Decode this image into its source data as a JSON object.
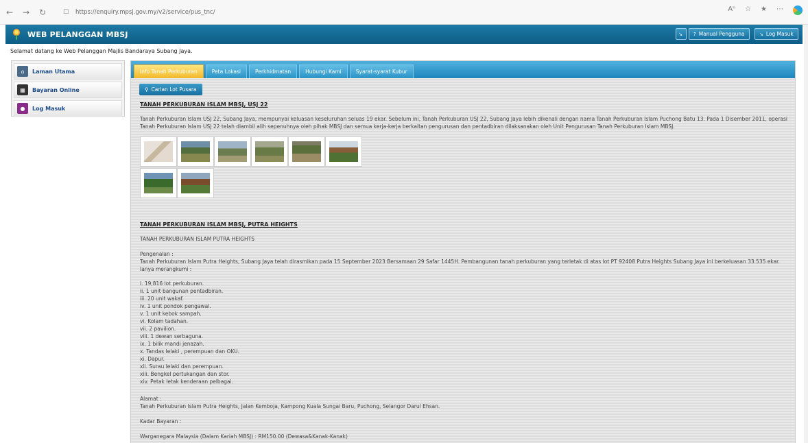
{
  "browser": {
    "url": "https://enquiry.mpsj.gov.my/v2/service/pus_tnc/"
  },
  "header": {
    "title": "WEB PELANGGAN MBSJ",
    "manual_label": "Manual Pengguna",
    "login_label": "Log Masuk"
  },
  "welcome": "Selamat datang ke Web Pelanggan Majlis Bandaraya Subang Jaya.",
  "sidebar": {
    "items": [
      {
        "label": "Laman Utama"
      },
      {
        "label": "Bayaran Online"
      },
      {
        "label": "Log Masuk"
      }
    ]
  },
  "tabs": [
    {
      "label": "Info Tanah Perkuburan"
    },
    {
      "label": "Peta Lokasi"
    },
    {
      "label": "Perkhidmatan"
    },
    {
      "label": "Hubungi Kami"
    },
    {
      "label": "Syarat-syarat Kubur"
    }
  ],
  "search_button": "Carian Lot Pusara",
  "section1": {
    "title": "TANAH PERKUBURAN ISLAM MBSJ, USJ 22",
    "body": "Tanah Perkuburan Islam USJ 22, Subang Jaya, mempunyai keluasan keseluruhan seluas 19 ekar. Sebelum ini, Tanah Perkuburan USJ 22, Subang Jaya lebih dikenali dengan nama Tanah Perkuburan Islam Puchong Batu 13. Pada 1 Disember 2011, operasi Tanah Perkuburan Islam USJ 22 telah diambil alih sepenuhnya oleh pihak MBSJ dan semua kerja-kerja berkaitan pengurusan dan pentadbiran dilaksanakan oleh Unit Pengurusan Tanah Perkuburan Islam MBSJ."
  },
  "section2": {
    "title": "TANAH PERKUBURAN ISLAM MBSJ, PUTRA HEIGHTS",
    "subtitle": "TANAH PERKUBURAN ISLAM PUTRA HEIGHTS",
    "intro_label": "Pengenalan :",
    "intro_body": "Tanah Perkuburan Islam Putra Heights, Subang Jaya telah dirasmikan pada 15 September 2023 Bersamaan 29 Safar 1445H. Pembangunan tanah perkuburan yang terletak di atas lot PT 92408 Putra Heights Subang Jaya ini berkeluasan 33.535 ekar. Ianya merangkumi :",
    "items": [
      "i. 19,816 lot perkuburan.",
      "ii. 1 unit bangunan pentadbiran.",
      "iii. 20 unit wakaf.",
      "iv. 1 unit pondok pengawal.",
      "v. 1 unit kebok sampah.",
      "vi. Kolam tadahan.",
      "vii. 2 pavilion.",
      "viii. 1 dewan serbaguna.",
      "ix. 1 bilik mandi jenazah.",
      "x. Tandas lelaki , perempuan dan OKU.",
      "xi. Dapur.",
      "xii. Surau lelaki dan perempuan.",
      "xiii. Bengkel pertukangan dan stor.",
      "xiv. Petak letak kenderaan pelbagai."
    ],
    "address_label": "Alamat :",
    "address": "Tanah Perkuburan Islam Putra Heights, Jalan Kemboja, Kampong Kuala Sungai Baru, Puchong, Selangor Darul Ehsan.",
    "rate_label": "Kadar Bayaran :",
    "rate_line": "Warganegara Malaysia (Dalam Kariah MBSJ) : RM150.00 (Dewasa&Kanak-Kanak)"
  }
}
